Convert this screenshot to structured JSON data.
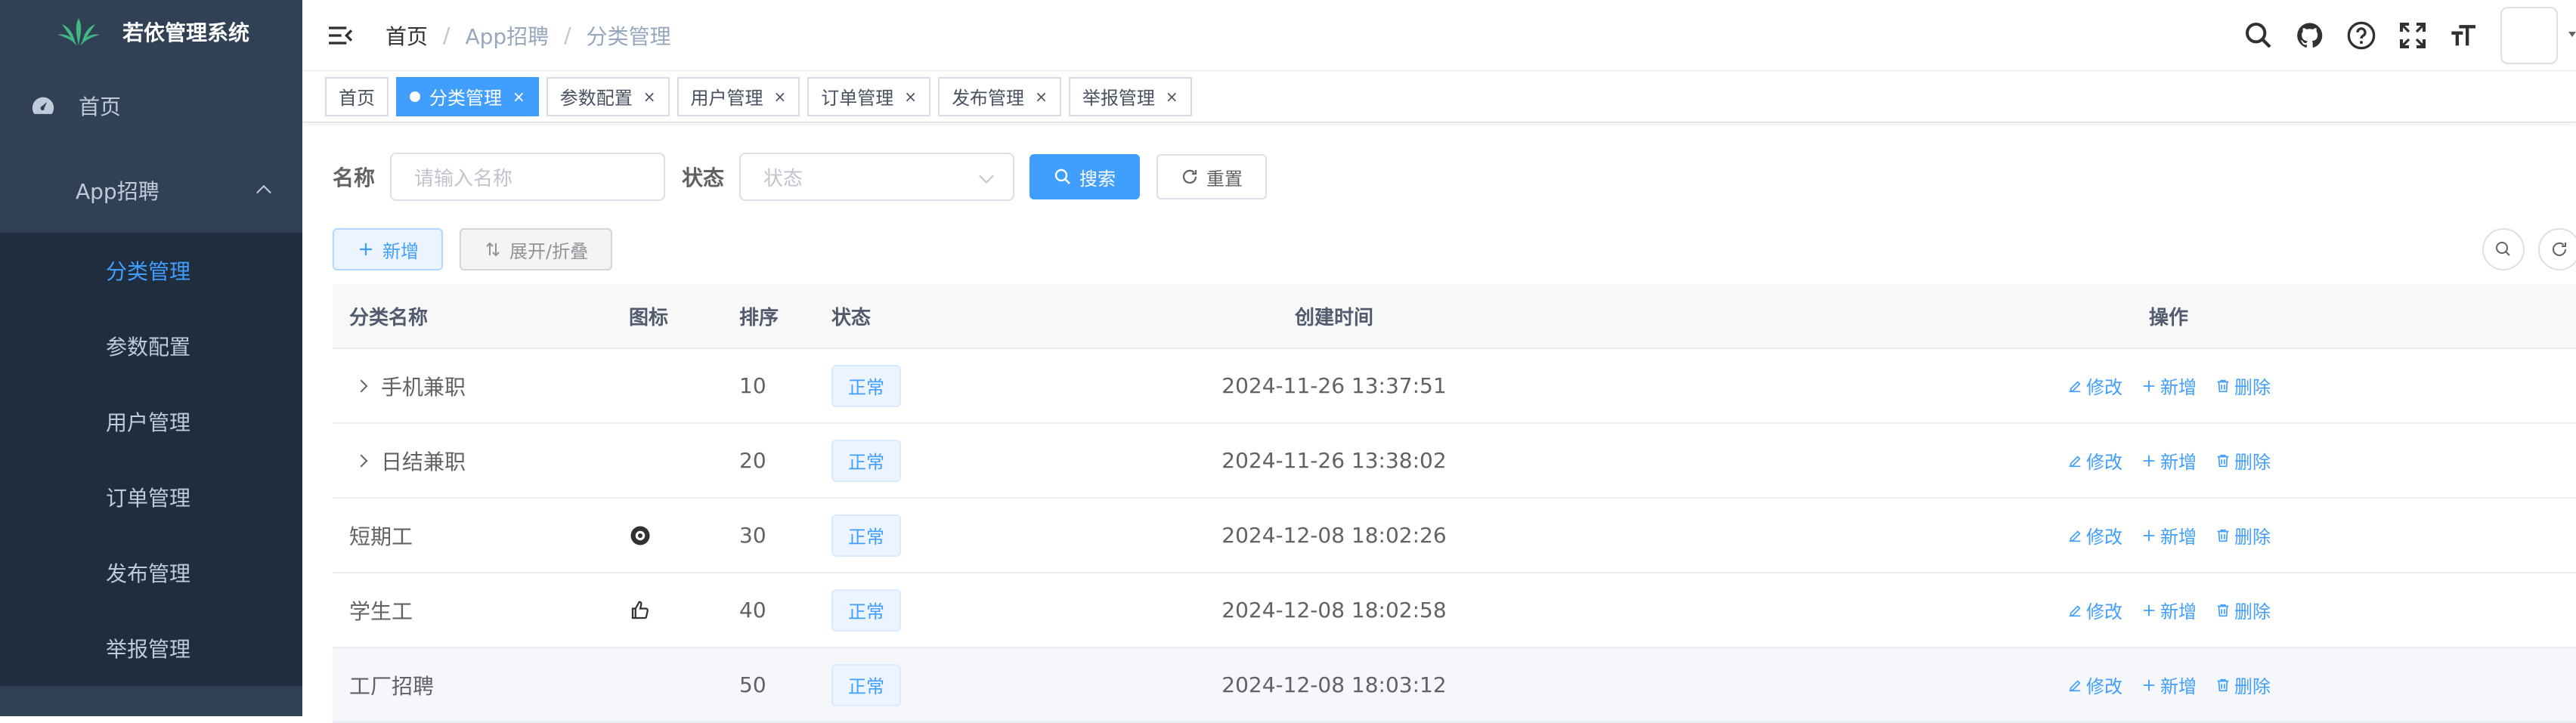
{
  "app": {
    "title": "若依管理系统"
  },
  "sidebar": {
    "home": "首页",
    "group": "App招聘",
    "items": [
      {
        "label": "分类管理",
        "active": true
      },
      {
        "label": "参数配置"
      },
      {
        "label": "用户管理"
      },
      {
        "label": "订单管理"
      },
      {
        "label": "发布管理"
      },
      {
        "label": "举报管理"
      }
    ]
  },
  "breadcrumb": [
    "首页",
    "App招聘",
    "分类管理"
  ],
  "tags": [
    {
      "label": "首页",
      "closable": false
    },
    {
      "label": "分类管理",
      "active": true,
      "close": "×"
    },
    {
      "label": "参数配置",
      "close": "×"
    },
    {
      "label": "用户管理",
      "close": "×"
    },
    {
      "label": "订单管理",
      "close": "×"
    },
    {
      "label": "发布管理",
      "close": "×"
    },
    {
      "label": "举报管理",
      "close": "×"
    }
  ],
  "search": {
    "name_label": "名称",
    "name_placeholder": "请输入名称",
    "status_label": "状态",
    "status_placeholder": "状态",
    "search_btn": "搜索",
    "reset_btn": "重置"
  },
  "toolbar": {
    "add_btn": "新增",
    "expand_btn": "展开/折叠"
  },
  "table": {
    "headers": [
      "分类名称",
      "图标",
      "排序",
      "状态",
      "创建时间",
      "操作"
    ],
    "ops": {
      "edit": "修改",
      "add": "新增",
      "delete": "删除"
    },
    "rows": [
      {
        "name": "手机兼职",
        "expandable": true,
        "icon": "",
        "sort": "10",
        "status": "正常",
        "time": "2024-11-26 13:37:51"
      },
      {
        "name": "日结兼职",
        "expandable": true,
        "icon": "",
        "sort": "20",
        "status": "正常",
        "time": "2024-11-26 13:38:02"
      },
      {
        "name": "短期工",
        "expandable": false,
        "icon": "badge-icon",
        "sort": "30",
        "status": "正常",
        "time": "2024-12-08 18:02:26"
      },
      {
        "name": "学生工",
        "expandable": false,
        "icon": "thumb-icon",
        "sort": "40",
        "status": "正常",
        "time": "2024-12-08 18:02:58"
      },
      {
        "name": "工厂招聘",
        "expandable": false,
        "icon": "",
        "sort": "50",
        "status": "正常",
        "time": "2024-12-08 18:03:12"
      }
    ]
  },
  "colors": {
    "sidebar_bg": "#304156",
    "submenu_bg": "#1f2d3d",
    "primary": "#409eff"
  }
}
